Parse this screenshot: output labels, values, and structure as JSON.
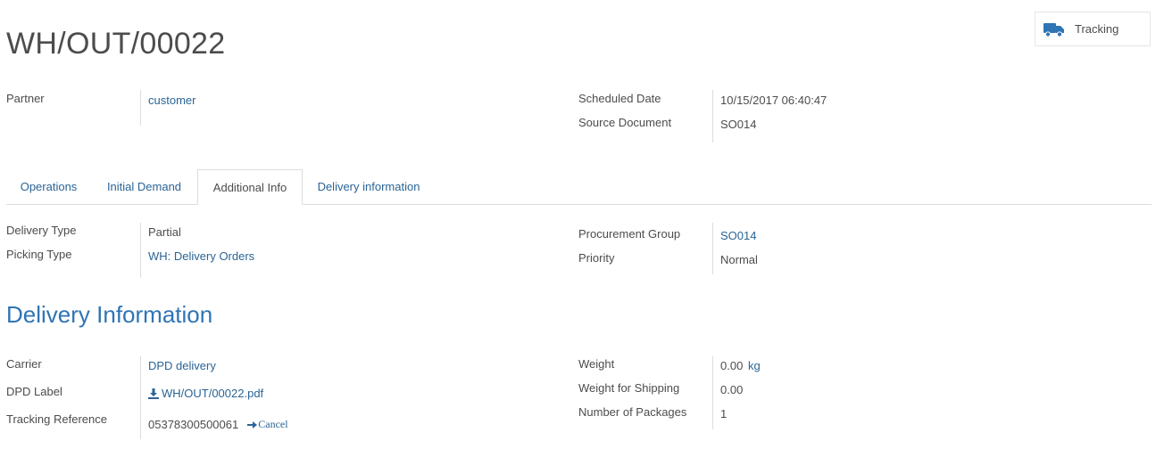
{
  "header": {
    "title": "WH/OUT/00022",
    "tracking_button": "Tracking"
  },
  "top_fields": {
    "partner_label": "Partner",
    "partner_value": "customer",
    "scheduled_date_label": "Scheduled Date",
    "scheduled_date_value": "10/15/2017 06:40:47",
    "source_document_label": "Source Document",
    "source_document_value": "SO014"
  },
  "tabs": [
    {
      "label": "Operations"
    },
    {
      "label": "Initial Demand"
    },
    {
      "label": "Additional Info"
    },
    {
      "label": "Delivery information"
    }
  ],
  "additional_info": {
    "delivery_type_label": "Delivery Type",
    "delivery_type_value": "Partial",
    "picking_type_label": "Picking Type",
    "picking_type_value": "WH: Delivery Orders",
    "procurement_group_label": "Procurement Group",
    "procurement_group_value": "SO014",
    "priority_label": "Priority",
    "priority_value": "Normal"
  },
  "delivery_information": {
    "section_title": "Delivery Information",
    "carrier_label": "Carrier",
    "carrier_value": "DPD delivery",
    "dpd_label_label": "DPD Label",
    "dpd_label_value": "WH/OUT/00022.pdf",
    "tracking_reference_label": "Tracking Reference",
    "tracking_reference_value": "05378300500061",
    "cancel_label": "Cancel",
    "weight_label": "Weight",
    "weight_value": "0.00",
    "weight_unit": "kg",
    "weight_shipping_label": "Weight for Shipping",
    "weight_shipping_value": "0.00",
    "packages_label": "Number of Packages",
    "packages_value": "1"
  },
  "colors": {
    "link": "#2a6496",
    "section_title": "#2f74b5",
    "text": "#4c4c4c",
    "border": "#dcdcdc"
  },
  "icons": {
    "tracking": "truck-icon",
    "download": "download-icon",
    "cancel_arrow": "arrow-right-icon"
  }
}
